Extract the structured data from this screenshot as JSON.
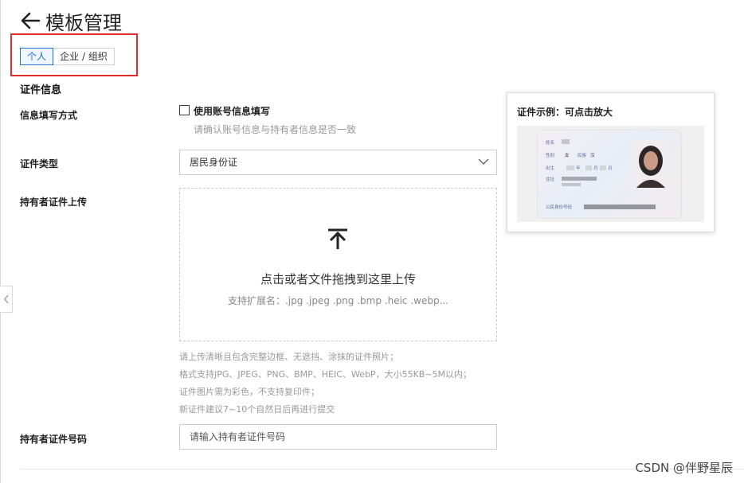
{
  "page": {
    "title": "模板管理"
  },
  "tabs": [
    {
      "label": "个人",
      "active": true
    },
    {
      "label": "企业 / 组织",
      "active": false
    }
  ],
  "colors": {
    "accent": "#1f73d1",
    "highlight_border": "#e02b2b"
  },
  "form": {
    "section_title": "证件信息",
    "fill_method": {
      "label": "信息填写方式",
      "checkbox_label": "使用账号信息填写",
      "checked": false,
      "hint": "请确认账号信息与持有者信息是否一致"
    },
    "id_type": {
      "label": "证件类型",
      "value": "居民身份证"
    },
    "upload": {
      "label": "持有者证件上传",
      "title": "点击或者文件拖拽到这里上传",
      "extensions": "支持扩展名：.jpg .jpeg .png .bmp .heic .webp...",
      "notes": [
        "请上传清晰且包含完整边框、无遮挡、涂抹的证件照片；",
        "格式支持JPG、JPEG、PNG、BMP、HEIC、WebP，大小55KB~5M以内；",
        "证件图片需为彩色，不支持复印件；",
        "新证件建议7~10个自然日后再进行提交"
      ]
    },
    "id_number": {
      "label": "持有者证件号码",
      "placeholder": "请输入持有者证件号码",
      "value": ""
    }
  },
  "example_popover": {
    "title": "证件示例：可点击放大",
    "card_labels": [
      "姓名",
      "性别",
      "民族",
      "出生",
      "年",
      "月",
      "日",
      "住址",
      "公民身份号码",
      "女",
      "汉"
    ]
  },
  "watermark": "CSDN @伴野星辰"
}
